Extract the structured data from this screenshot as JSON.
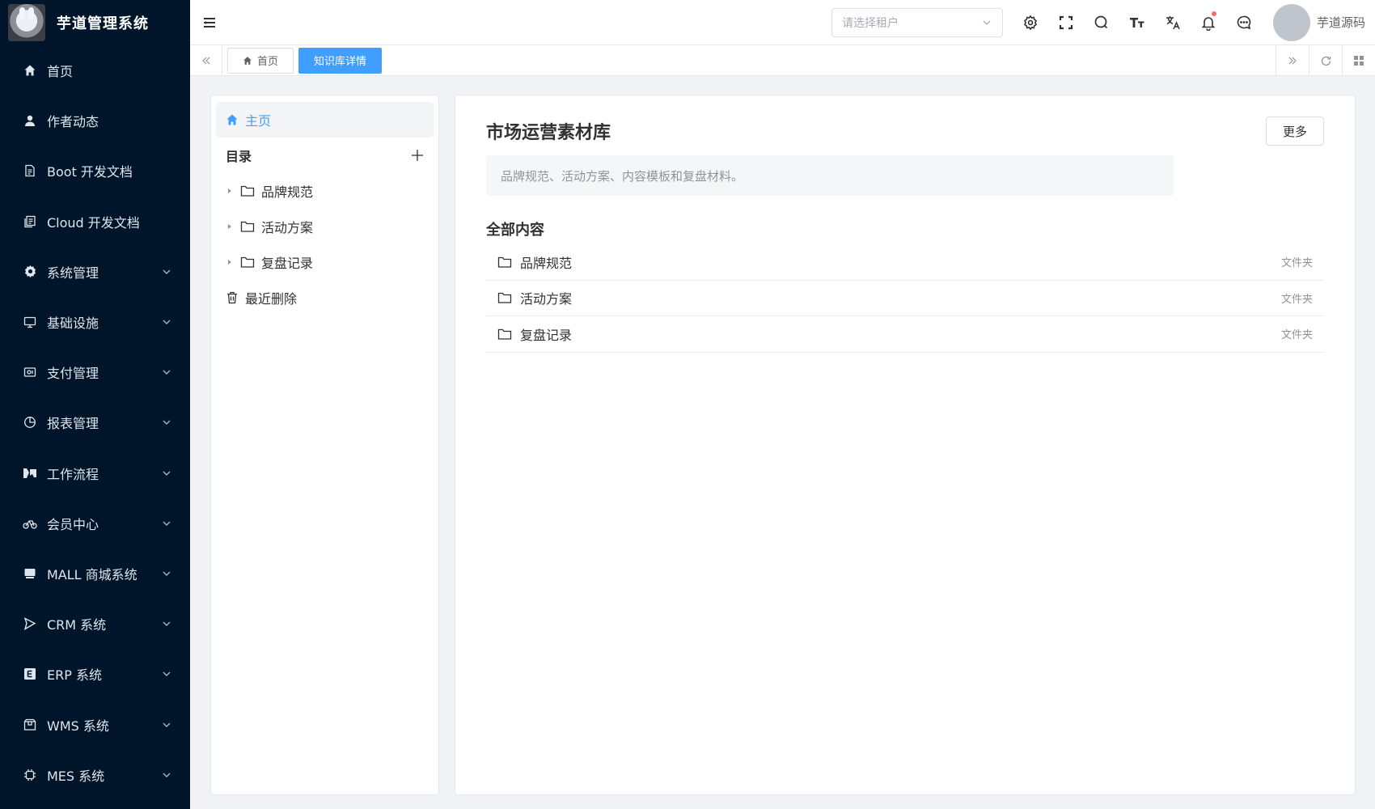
{
  "app": {
    "title": "芋道管理系统"
  },
  "sidebar": {
    "items": [
      {
        "label": "首页",
        "icon": "home-icon",
        "expandable": false
      },
      {
        "label": "作者动态",
        "icon": "user-icon",
        "expandable": false
      },
      {
        "label": "Boot 开发文档",
        "icon": "document-icon",
        "expandable": false
      },
      {
        "label": "Cloud 开发文档",
        "icon": "documents-icon",
        "expandable": false
      },
      {
        "label": "系统管理",
        "icon": "gear-icon",
        "expandable": true
      },
      {
        "label": "基础设施",
        "icon": "monitor-icon",
        "expandable": true
      },
      {
        "label": "支付管理",
        "icon": "wallet-icon",
        "expandable": true
      },
      {
        "label": "报表管理",
        "icon": "pie-chart-icon",
        "expandable": true
      },
      {
        "label": "工作流程",
        "icon": "workflow-icon",
        "expandable": true
      },
      {
        "label": "会员中心",
        "icon": "bicycle-icon",
        "expandable": true
      },
      {
        "label": "MALL 商城系统",
        "icon": "shop-icon",
        "expandable": true
      },
      {
        "label": "CRM 系统",
        "icon": "crm-icon",
        "expandable": true
      },
      {
        "label": "ERP 系统",
        "icon": "erp-icon",
        "expandable": true
      },
      {
        "label": "WMS 系统",
        "icon": "warehouse-icon",
        "expandable": true
      },
      {
        "label": "MES 系统",
        "icon": "chip-icon",
        "expandable": true
      }
    ]
  },
  "header": {
    "tenant_placeholder": "请选择租户",
    "username": "芋道源码"
  },
  "tags": {
    "items": [
      {
        "label": "首页",
        "active": false
      },
      {
        "label": "知识库详情",
        "active": true
      }
    ]
  },
  "tree": {
    "home_label": "主页",
    "directory_label": "目录",
    "nodes": [
      {
        "label": "品牌规范"
      },
      {
        "label": "活动方案"
      },
      {
        "label": "复盘记录"
      }
    ],
    "trash_label": "最近删除"
  },
  "content": {
    "title": "市场运营素材库",
    "more_label": "更多",
    "description": "品牌规范、活动方案、内容模板和复盘材料。",
    "section_title": "全部内容",
    "rows": [
      {
        "name": "品牌规范",
        "type": "文件夹"
      },
      {
        "name": "活动方案",
        "type": "文件夹"
      },
      {
        "name": "复盘记录",
        "type": "文件夹"
      }
    ]
  },
  "colors": {
    "sidebar_bg": "#001529",
    "accent": "#409eff",
    "notification_dot": "#f56c6c"
  }
}
